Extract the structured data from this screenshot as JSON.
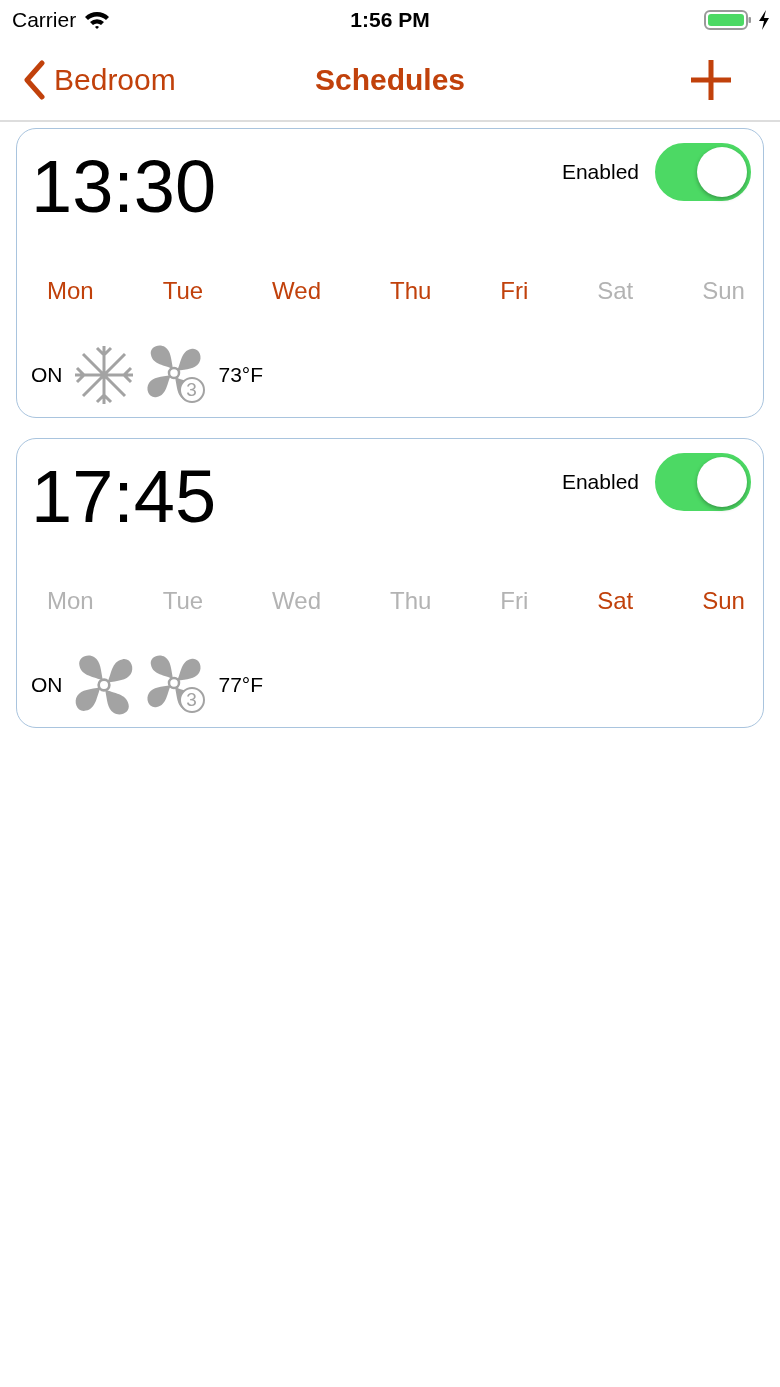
{
  "status_bar": {
    "carrier": "Carrier",
    "time": "1:56 PM"
  },
  "nav": {
    "back": "Bedroom",
    "title": "Schedules"
  },
  "schedules": [
    {
      "time": "13:30",
      "enabled_label": "Enabled",
      "enabled": true,
      "days": [
        {
          "label": "Mon",
          "selected": true
        },
        {
          "label": "Tue",
          "selected": true
        },
        {
          "label": "Wed",
          "selected": true
        },
        {
          "label": "Thu",
          "selected": true
        },
        {
          "label": "Fri",
          "selected": true
        },
        {
          "label": "Sat",
          "selected": false
        },
        {
          "label": "Sun",
          "selected": false
        }
      ],
      "power": "ON",
      "mode": {
        "kind": "cool"
      },
      "fan_speed": "3",
      "temperature": "73°F"
    },
    {
      "time": "17:45",
      "enabled_label": "Enabled",
      "enabled": true,
      "days": [
        {
          "label": "Mon",
          "selected": false
        },
        {
          "label": "Tue",
          "selected": false
        },
        {
          "label": "Wed",
          "selected": false
        },
        {
          "label": "Thu",
          "selected": false
        },
        {
          "label": "Fri",
          "selected": false
        },
        {
          "label": "Sat",
          "selected": true
        },
        {
          "label": "Sun",
          "selected": true
        }
      ],
      "power": "ON",
      "mode": {
        "kind": "fan"
      },
      "fan_speed": "3",
      "temperature": "77°F"
    }
  ]
}
